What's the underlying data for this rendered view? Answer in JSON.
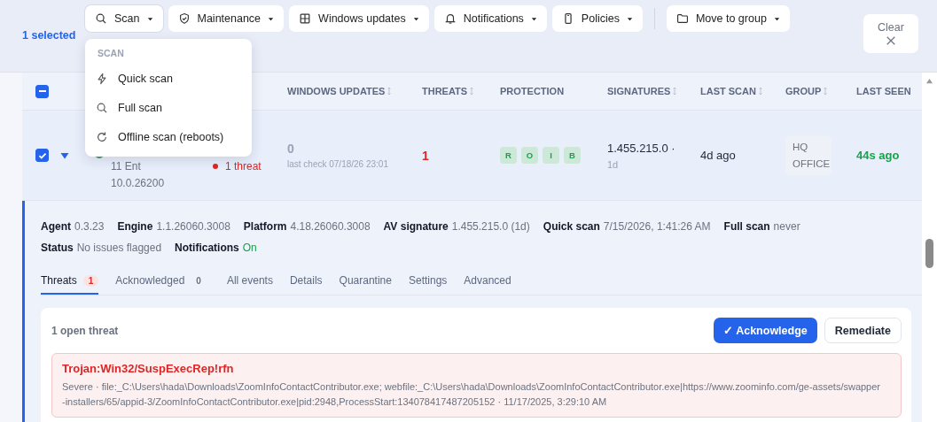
{
  "selection": {
    "text": "1 selected"
  },
  "toolbar": {
    "buttons": [
      {
        "label": "Scan",
        "open": true
      },
      {
        "label": "Maintenance",
        "open": false
      },
      {
        "label": "Windows updates",
        "open": false
      },
      {
        "label": "Notifications",
        "open": false
      },
      {
        "label": "Policies",
        "open": false
      },
      {
        "label": "Move to group",
        "open": false
      }
    ],
    "clear": "Clear"
  },
  "dropdown": {
    "heading": "SCAN",
    "items": [
      {
        "label": "Quick scan"
      },
      {
        "label": "Full scan"
      },
      {
        "label": "Offline scan (reboots)"
      }
    ]
  },
  "table": {
    "header_checkbox_indeterminate": true,
    "columns": [
      {
        "label": "WINDOWS UPDATES",
        "sortable": true
      },
      {
        "label": "THREATS",
        "sortable": true
      },
      {
        "label": "PROTECTION",
        "sortable": false
      },
      {
        "label": "SIGNATURES",
        "sortable": true
      },
      {
        "label": "LAST SCAN",
        "sortable": true
      },
      {
        "label": "GROUP",
        "sortable": true
      },
      {
        "label": "LAST SEEN",
        "sortable": false
      }
    ],
    "rows": [
      {
        "checked": true,
        "expanded": true,
        "os_lines": [
          "11 Ent",
          "10.0.26200"
        ],
        "issues": "1 threat",
        "windows_updates": "0",
        "last_check": "last check 07/18/26 23:01",
        "threats": "1",
        "protection": [
          {
            "letter": "R",
            "on": true
          },
          {
            "letter": "O",
            "on": true
          },
          {
            "letter": "I",
            "on": true
          },
          {
            "letter": "B",
            "on": true
          }
        ],
        "signature": "1.455.215.0 ·",
        "signature_age": "1d",
        "last_scan": "4d ago",
        "group": "HQ OFFICE",
        "last_seen": "44s ago"
      }
    ]
  },
  "details": {
    "fact_lines": [
      [
        {
          "label": "Agent",
          "value": "0.3.23",
          "good": false
        },
        {
          "label": "Engine",
          "value": "1.1.26060.3008",
          "good": false
        },
        {
          "label": "Platform",
          "value": "4.18.26060.3008",
          "good": false
        },
        {
          "label": "AV signature",
          "value": "1.455.215.0 (1d)",
          "good": false
        },
        {
          "label": "Quick scan",
          "value": "7/15/2026, 1:41:26 AM",
          "good": false
        },
        {
          "label": "Full scan",
          "value": "never",
          "good": false
        }
      ],
      [
        {
          "label": "Status",
          "value": "No issues flagged",
          "good": false
        },
        {
          "label": "Notifications",
          "value": "On",
          "good": true
        }
      ]
    ],
    "tabs": [
      {
        "label": "Threats",
        "count": "1",
        "alert": true,
        "selected": true
      },
      {
        "label": "Acknowledged",
        "count": "0",
        "alert": false,
        "selected": false
      },
      {
        "label": "All events",
        "selected": false
      },
      {
        "label": "Details",
        "selected": false
      },
      {
        "label": "Quarantine",
        "selected": false
      },
      {
        "label": "Settings",
        "selected": false
      },
      {
        "label": "Advanced",
        "selected": false
      }
    ],
    "threat_panel": {
      "summary": "1 open threat",
      "buttons": [
        {
          "label": "✓ Acknowledge",
          "kind": "primary"
        },
        {
          "label": "Remediate",
          "kind": "secondary"
        }
      ],
      "threats": [
        {
          "name": "Trojan:Win32/SuspExecRep!rfn",
          "description": "Severe · file:_C:\\Users\\hada\\Downloads\\ZoomInfoContactContributor.exe; webfile:_C:\\Users\\hada\\Downloads\\ZoomInfoContactContributor.exe|https://www.zoominfo.com/ge-assets/swapper-installers/65/appid-3/ZoomInfoContactContributor.exe|pid:2948,ProcessStart:134078417487205152 · 11/17/2025, 3:29:10 AM"
        }
      ]
    }
  }
}
